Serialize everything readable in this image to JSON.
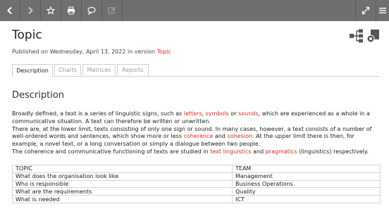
{
  "toolbar": {
    "buttons_left": [
      {
        "name": "back-button",
        "icon": "chevron-left-icon"
      },
      {
        "name": "forward-button",
        "icon": "chevron-right-icon"
      },
      {
        "name": "favorite-button",
        "icon": "star-icon"
      },
      {
        "name": "print-button",
        "icon": "printer-icon"
      },
      {
        "name": "comment-button",
        "icon": "speech-bubble-icon"
      },
      {
        "name": "edit-button",
        "icon": "edit-icon"
      }
    ],
    "buttons_right": [
      {
        "name": "expand-button",
        "icon": "expand-icon"
      },
      {
        "name": "menu-button",
        "icon": "hamburger-icon"
      }
    ],
    "colors": {
      "background": "#6f6f6f",
      "icon": "#ffffff"
    }
  },
  "page": {
    "title": "Topic",
    "published_prefix": "Published on Wednesday, April 13, 2022 in version",
    "version_link": "Topic"
  },
  "tabs": [
    {
      "label": "Description",
      "active": true
    },
    {
      "label": "Charts",
      "active": false
    },
    {
      "label": "Matrices",
      "active": false
    },
    {
      "label": "Reports",
      "active": false
    }
  ],
  "description": {
    "heading": "Description",
    "p1_a": "Broadly defined, a text is a series of linguistic signs, such as",
    "link_letters": "letters",
    "p1_sep1": ",",
    "link_symbols": "symbols",
    "p1_or": "or",
    "link_sounds": "sounds",
    "p1_b": ", which are experienced as a whole in a communicative situation. A text can therefore be written or unwritten.",
    "p2_a": "There are, at the lower limit, texts consisting of only one sign or sound. In many cases, however, a text consists of a number of well-ordered words and sentences, which show more or less",
    "link_coherence": "coherence",
    "p2_and": "and",
    "link_cohesion": "cohesion",
    "p2_b": ". At the upper limit there is then, for example, a novel text, or a long conversation or simply a dialogue between two people.",
    "p3_a": "The coherence and communicative functioning of texts are studied in",
    "link_textling": "text linguistics",
    "p3_and": "and",
    "link_pragmatics": "pragmatics",
    "p3_b": "(linguistics) respectively.",
    "link_color": "#d9281f"
  },
  "table": {
    "header": [
      "TOPIC",
      "TEAM"
    ],
    "rows": [
      [
        "What does the organisation look like",
        "Management"
      ],
      [
        "Who is responsible",
        "Business Operations"
      ],
      [
        "What are the requirements",
        "Quality"
      ],
      [
        "What is needed",
        "ICT"
      ]
    ]
  }
}
